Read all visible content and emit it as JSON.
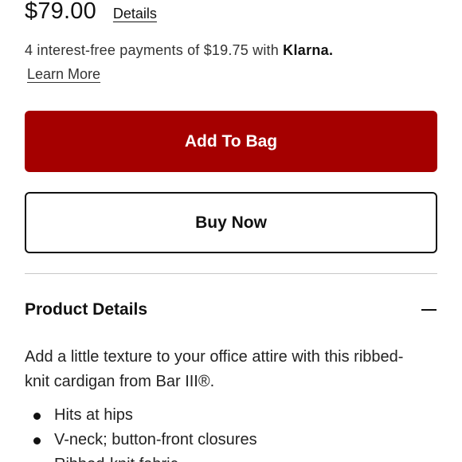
{
  "product": {
    "price": "$79.00",
    "details_link": "Details"
  },
  "payment": {
    "text": "4 interest-free payments of $19.75 with",
    "brand": "Klarna.",
    "learn_more": "Learn More"
  },
  "actions": {
    "add_to_bag": "Add To Bag",
    "buy_now": "Buy Now",
    "add_to_bag_color": "#a50000"
  },
  "product_details": {
    "title": "Product Details",
    "toggle_icon": "minus-icon",
    "description": "Add a little texture to your office attire with this ribbed-knit cardigan from Bar III®.",
    "bullets": [
      "Hits at hips",
      "V-neck; button-front closures",
      "Ribbed-knit fabric"
    ]
  }
}
